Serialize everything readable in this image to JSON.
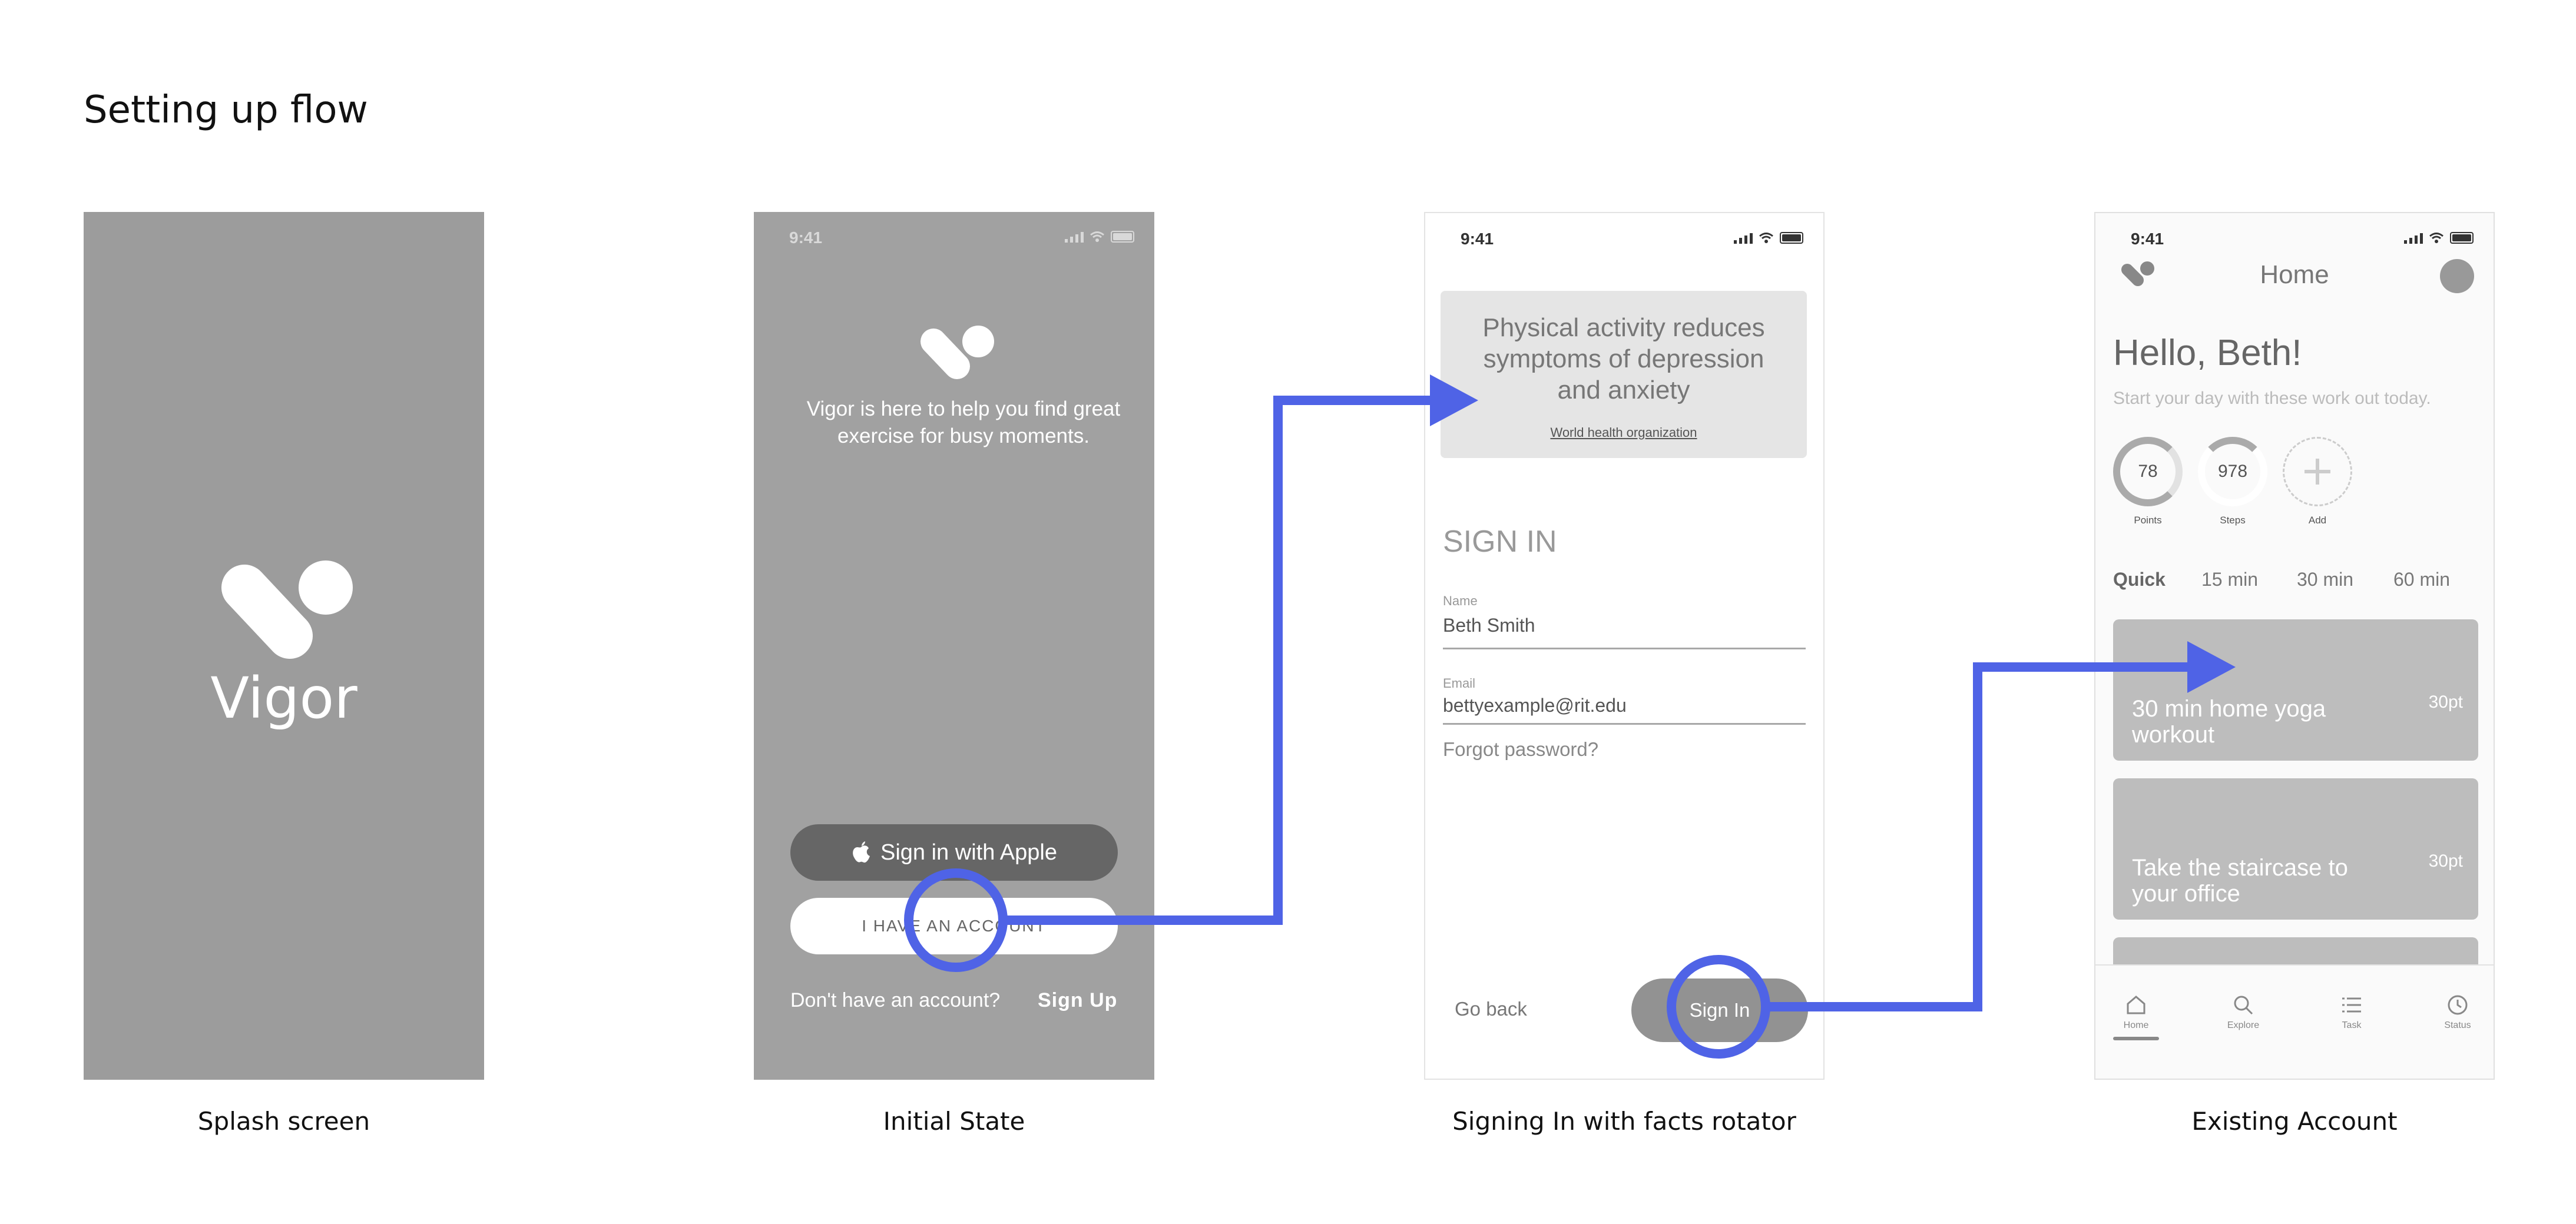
{
  "page": {
    "title": "Setting up flow"
  },
  "captions": [
    "Splash screen",
    "Initial State",
    "Signing In with facts rotator",
    "Existing Account"
  ],
  "status": {
    "time": "9:41"
  },
  "splash": {
    "brand": "Vigor"
  },
  "initial": {
    "tagline_line1": "Vigor is here to help you find great",
    "tagline_line2": "exercise for busy moments.",
    "apple_button": "Sign in with Apple",
    "account_button": "I HAVE AN ACCOUNT",
    "no_account": "Don't have an account?",
    "sign_up": "Sign Up"
  },
  "signin": {
    "fact_line1": "Physical activity reduces",
    "fact_line2": "symptoms of depression",
    "fact_line3": "and anxiety",
    "fact_source": "World health organization",
    "heading": "SIGN IN",
    "name_label": "Name",
    "name_value": "Beth Smith",
    "email_label": "Email",
    "email_value": "bettyexample@rit.edu",
    "forgot": "Forgot password?",
    "go_back": "Go back",
    "sign_in": "Sign In"
  },
  "home": {
    "title": "Home",
    "greeting": "Hello, Beth!",
    "subtitle": "Start your day with these work out today.",
    "rings": [
      {
        "value": "78",
        "label": "Points"
      },
      {
        "value": "978",
        "label": "Steps"
      },
      {
        "value": "",
        "label": "Add"
      }
    ],
    "quick_label": "Quick",
    "quick_options": [
      "15 min",
      "30 min",
      "60 min"
    ],
    "cards": [
      {
        "title": "30 min home yoga workout",
        "points": "30pt"
      },
      {
        "title": "Take the staircase to your office",
        "points": "30pt"
      }
    ],
    "tabs": [
      "Home",
      "Explore",
      "Task",
      "Status"
    ]
  },
  "colors": {
    "accent": "#4f63e6",
    "frame_gray": "#a1a1a1",
    "splash_gray": "#9c9c9c"
  }
}
